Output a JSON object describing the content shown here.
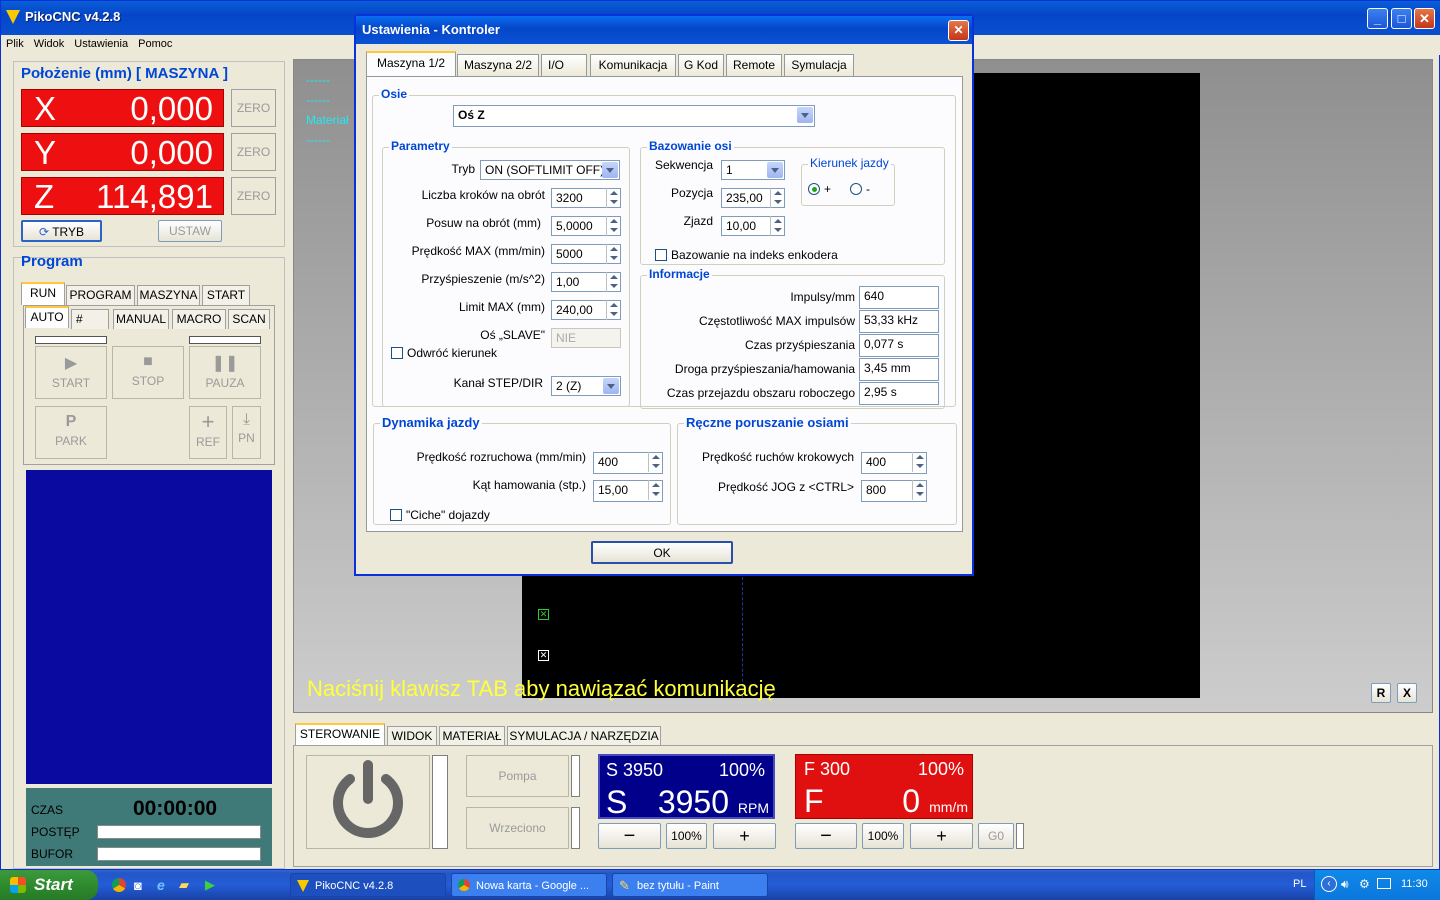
{
  "app": {
    "title": "PikoCNC v4.2.8",
    "menu": [
      "Plik",
      "Widok",
      "Ustawienia",
      "Pomoc"
    ]
  },
  "position": {
    "title": "Położenie (mm) [ MASZYNA ]",
    "axes": [
      {
        "label": "X",
        "value": "0,000"
      },
      {
        "label": "Y",
        "value": "0,000"
      },
      {
        "label": "Z",
        "value": "114,891"
      }
    ],
    "zero_label": "ZERO",
    "mode_button": "TRYB",
    "set_button": "USTAW"
  },
  "program": {
    "title": "Program",
    "tabs": [
      "RUN",
      "PROGRAM",
      "MASZYNA",
      "START"
    ],
    "subtabs": [
      "AUTO",
      "#",
      "MANUAL",
      "MACRO",
      "SCAN"
    ],
    "buttons": {
      "start": "START",
      "stop": "STOP",
      "pause": "PAUZA",
      "park": "PARK",
      "ref": "REF",
      "pn": "PN"
    },
    "status": {
      "time_label": "CZAS",
      "time_value": "00:00:00",
      "progress_label": "POSTĘP",
      "buffer_label": "BUFOR"
    }
  },
  "canvas": {
    "side_labels": [
      "------",
      "------",
      "Materiał",
      "------"
    ],
    "message": "Naciśnij klawisz TAB aby nawiązać komunikację",
    "r_button": "R",
    "x_button": "X"
  },
  "bottom": {
    "tabs": [
      "STEROWANIE",
      "WIDOK",
      "MATERIAŁ",
      "SYMULACJA / NARZĘDZIA"
    ],
    "pump": "Pompa",
    "spindle": "Wrzeciono",
    "s_panel": {
      "top_left": "S 3950",
      "top_right": "100%",
      "letter": "S",
      "value": "3950",
      "unit": "RPM",
      "pct_button": "100%",
      "color": "#00008b"
    },
    "f_panel": {
      "top_left": "F 300",
      "top_right": "100%",
      "letter": "F",
      "value": "0",
      "unit": "mm/m",
      "pct_button": "100%",
      "color": "#e01010"
    },
    "go_button": "G0"
  },
  "dialog": {
    "title": "Ustawienia - Kontroler",
    "tabs": [
      "Maszyna 1/2",
      "Maszyna 2/2",
      "I/O",
      "Komunikacja",
      "G Kod",
      "Remote",
      "Symulacja"
    ],
    "osie": {
      "legend": "Osie",
      "selected": "Oś Z"
    },
    "parametry": {
      "legend": "Parametry",
      "tryb_label": "Tryb",
      "tryb_value": "ON (SOFTLIMIT OFF)",
      "rows": [
        {
          "label": "Liczba kroków na obrót",
          "value": "3200"
        },
        {
          "label": "Posuw na obrót (mm)",
          "value": "5,0000"
        },
        {
          "label": "Prędkość MAX (mm/min)",
          "value": "5000"
        },
        {
          "label": "Przyśpieszenie (m/s^2)",
          "value": "1,00"
        },
        {
          "label": "Limit MAX (mm)",
          "value": "240,00"
        }
      ],
      "slave_label": "Oś „SLAVE\"",
      "slave_value": "NIE",
      "invert_label": "Odwróć kierunek",
      "channel_label": "Kanał STEP/DIR",
      "channel_value": "2 (Z)"
    },
    "bazowanie": {
      "legend": "Bazowanie osi",
      "sequence_label": "Sekwencja",
      "sequence_value": "1",
      "position_label": "Pozycja",
      "position_value": "235,00",
      "exit_label": "Zjazd",
      "exit_value": "10,00",
      "direction_legend": "Kierunek jazdy",
      "plus": "+",
      "minus": "-",
      "encoder_label": "Bazowanie na indeks enkodera"
    },
    "informacje": {
      "legend": "Informacje",
      "rows": [
        {
          "label": "Impulsy/mm",
          "value": "640"
        },
        {
          "label": "Częstotliwość MAX impulsów",
          "value": "53,33 kHz"
        },
        {
          "label": "Czas przyśpieszania",
          "value": "0,077 s"
        },
        {
          "label": "Droga przyśpieszania/hamowania",
          "value": "3,45 mm"
        },
        {
          "label": "Czas przejazdu obszaru roboczego",
          "value": "2,95 s"
        }
      ]
    },
    "dynamika": {
      "legend": "Dynamika jazdy",
      "start_speed_label": "Prędkość rozruchowa (mm/min)",
      "start_speed_value": "400",
      "brake_angle_label": "Kąt hamowania (stp.)",
      "brake_angle_value": "15,00",
      "quiet_label": "\"Ciche\" dojazdy"
    },
    "reczne": {
      "legend": "Ręczne poruszanie osiami",
      "step_speed_label": "Prędkość ruchów krokowych",
      "step_speed_value": "400",
      "jog_label": "Prędkość  JOG z <CTRL>",
      "jog_value": "800"
    },
    "ok": "OK"
  },
  "taskbar": {
    "start": "Start",
    "items": [
      "PikoCNC v4.2.8",
      "Nowa karta - Google ...",
      "bez tytułu - Paint"
    ],
    "lang": "PL",
    "clock": "11:30"
  }
}
